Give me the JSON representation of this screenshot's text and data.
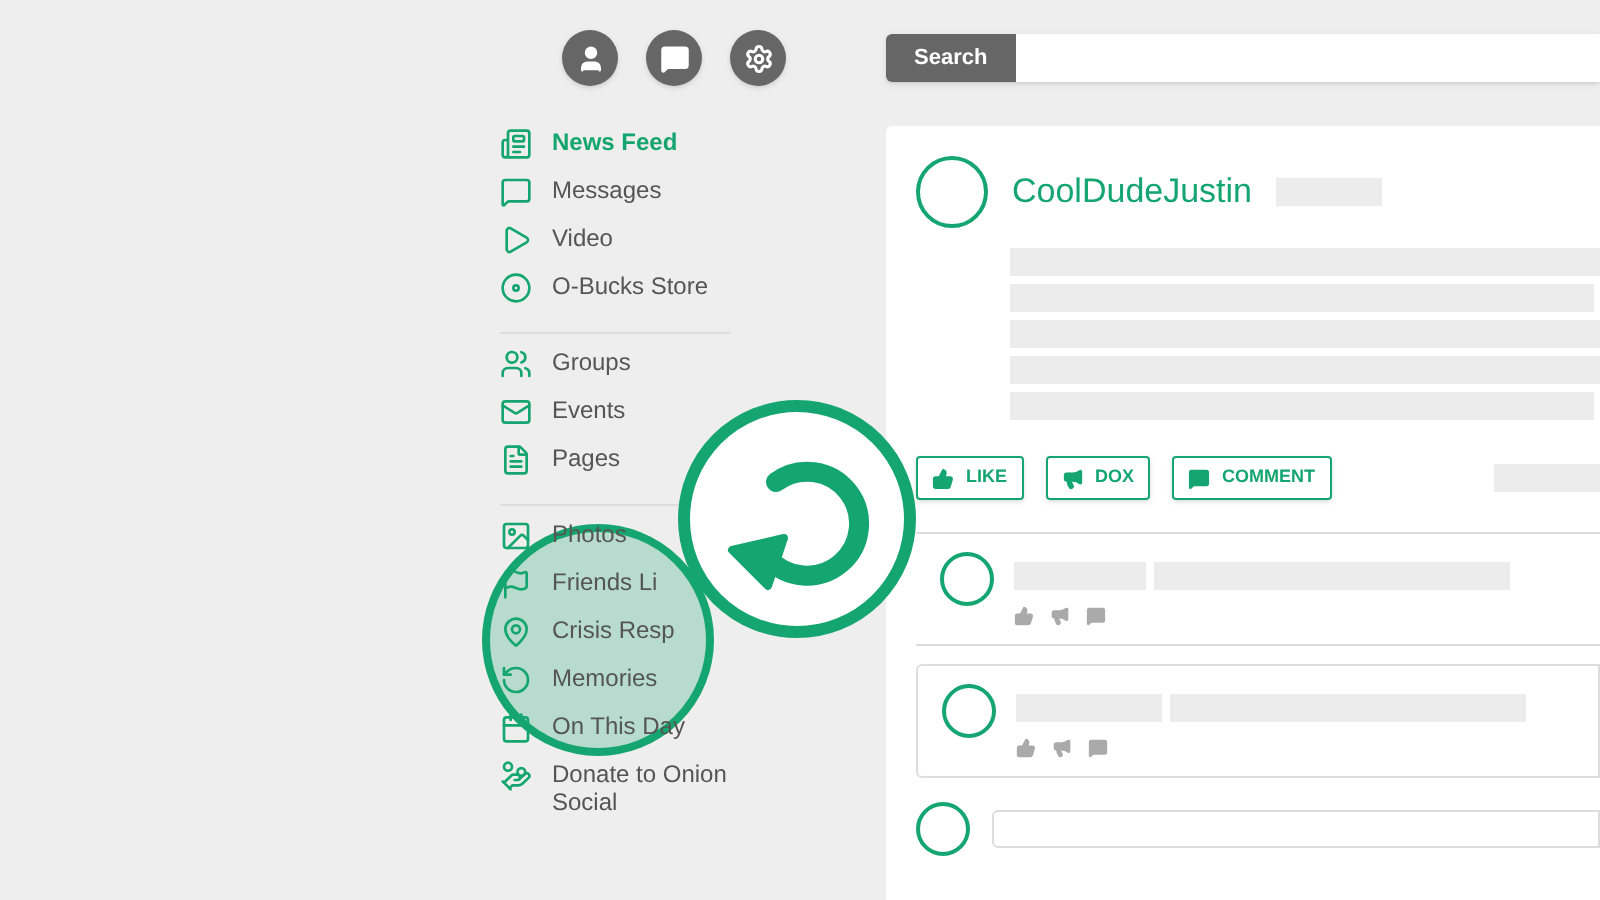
{
  "search": {
    "button": "Search"
  },
  "sidebar": {
    "groups": [
      [
        {
          "label": "News Feed",
          "selected": true
        },
        {
          "label": "Messages",
          "selected": false
        },
        {
          "label": "Video",
          "selected": false
        },
        {
          "label": "O-Bucks Store",
          "selected": false
        }
      ],
      [
        {
          "label": "Groups",
          "selected": false
        },
        {
          "label": "Events",
          "selected": false
        },
        {
          "label": "Pages",
          "selected": false
        }
      ],
      [
        {
          "label": "Photos",
          "selected": false
        },
        {
          "label": "Friends Li",
          "selected": false
        },
        {
          "label": "Crisis Resp",
          "selected": false
        },
        {
          "label": "Memories",
          "selected": false
        },
        {
          "label": "On This Day",
          "selected": false
        },
        {
          "label": "Donate to Onion Social",
          "selected": false
        }
      ]
    ]
  },
  "post": {
    "author": "CoolDudeJustin",
    "actions": [
      {
        "label": "LIKE",
        "kind": "like"
      },
      {
        "label": "DOX",
        "kind": "dox"
      },
      {
        "label": "COMMENT",
        "kind": "comment"
      }
    ]
  }
}
